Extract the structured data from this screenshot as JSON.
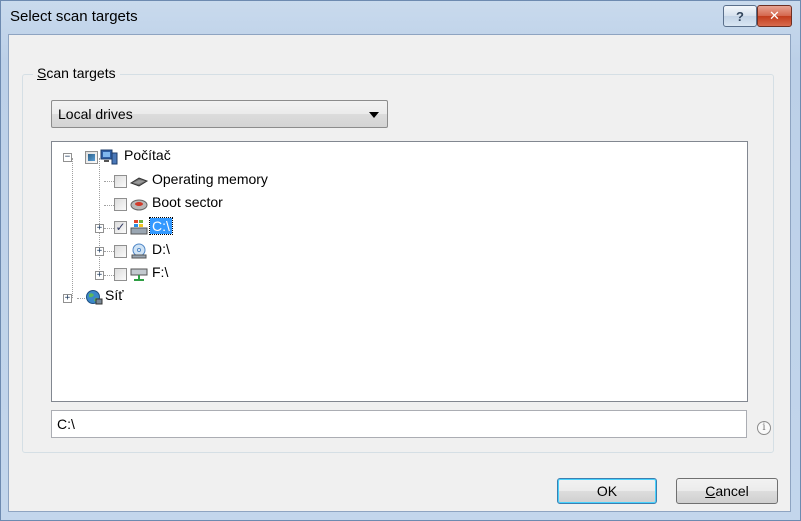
{
  "window": {
    "title": "Select scan targets",
    "help_label": "?",
    "close_label": "✕"
  },
  "group": {
    "legend_accel": "S",
    "legend_rest": "can targets"
  },
  "combo": {
    "value": "Local drives"
  },
  "tree": {
    "expander_expanded": "−",
    "expander_collapsed": "+",
    "check_mark": "✓",
    "nodes": [
      {
        "label": "Počítač",
        "icon": "computer-icon",
        "check": "partial",
        "expanded": true
      },
      {
        "label": "Operating memory",
        "icon": "memory-chip-icon",
        "check": "unchecked"
      },
      {
        "label": "Boot sector",
        "icon": "hard-disk-icon",
        "check": "unchecked"
      },
      {
        "label": "C:\\",
        "icon": "windows-drive-icon",
        "check": "checked",
        "selected": true
      },
      {
        "label": "D:\\",
        "icon": "optical-drive-icon",
        "check": "unchecked"
      },
      {
        "label": "F:\\",
        "icon": "network-drive-icon",
        "check": "unchecked"
      },
      {
        "label": "Síť",
        "icon": "network-globe-icon",
        "check": "none"
      }
    ]
  },
  "path_field": {
    "value": "C:\\"
  },
  "info_icon_glyph": "i",
  "buttons": {
    "ok_label": "OK",
    "cancel_accel": "C",
    "cancel_rest": "ancel"
  },
  "colors": {
    "selection": "#3399ff",
    "title_gradient_top": "#c9daed",
    "close_red": "#c23c1d"
  }
}
